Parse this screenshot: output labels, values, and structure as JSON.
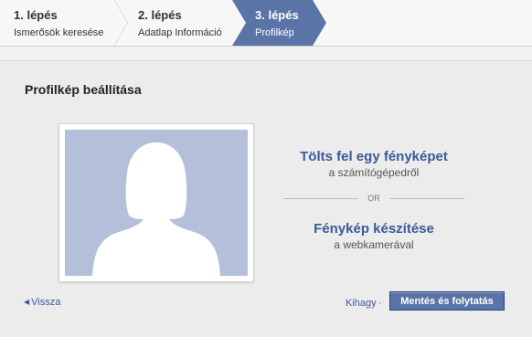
{
  "steps": [
    {
      "number": "1. lépés",
      "label": "Ismerősök keresése",
      "active": false
    },
    {
      "number": "2. lépés",
      "label": "Adatlap Információ",
      "active": false
    },
    {
      "number": "3. lépés",
      "label": "Profilkép",
      "active": true
    }
  ],
  "colors": {
    "active_step": "#5b74a8",
    "link": "#3b5998",
    "button": "#5b74a8",
    "placeholder_bg": "#b4bfd9"
  },
  "section": {
    "title": "Profilkép beállítása"
  },
  "upload": {
    "link": "Tölts fel egy fényképet",
    "sub": "a számítógépedről"
  },
  "divider": {
    "text": "OR"
  },
  "webcam": {
    "link": "Fénykép készítése",
    "sub": "a webkamerával"
  },
  "footer": {
    "back": "Vissza",
    "skip": "Kihagy",
    "separator": "·",
    "save": "Mentés és folytatás"
  },
  "icons": {
    "profile_placeholder": "female-silhouette-icon",
    "back_arrow": "triangle-left-icon"
  }
}
